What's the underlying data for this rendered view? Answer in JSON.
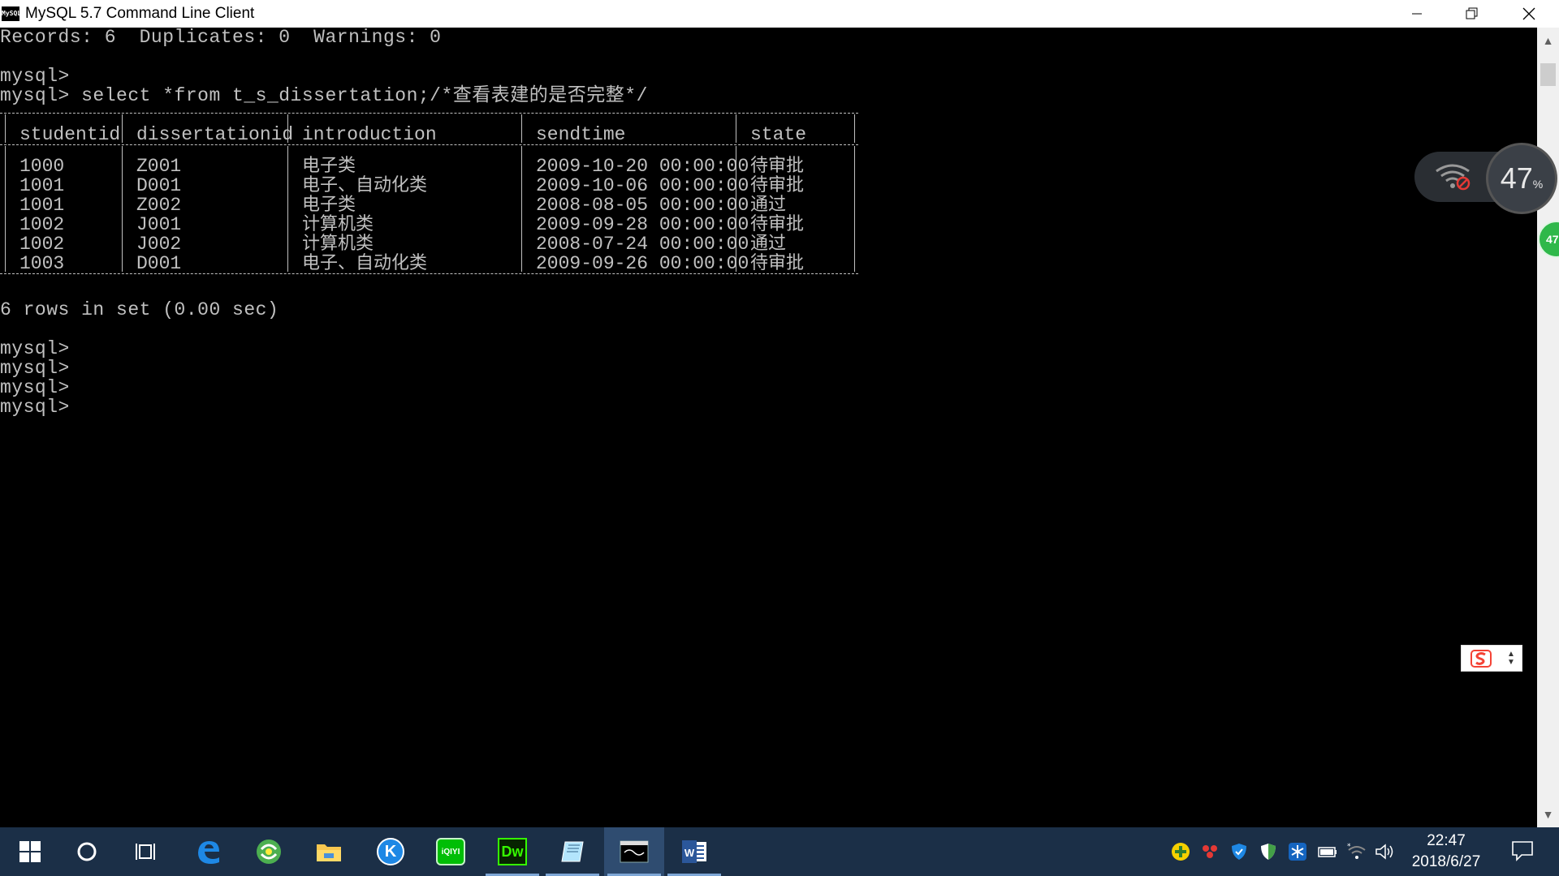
{
  "window": {
    "title": "MySQL 5.7 Command Line Client",
    "icon_label": "MySQL"
  },
  "console": {
    "lines_top": [
      "Records: 6  Duplicates: 0  Warnings: 0",
      "",
      "mysql>",
      "mysql> select *from t_s_dissertation;/*查看表建的是否完整*/"
    ],
    "table": {
      "columns": [
        "studentid",
        "dissertationid",
        "introduction",
        "sendtime",
        "state"
      ],
      "rows": [
        [
          "1000",
          "Z001",
          "电子类",
          "2009-10-20 00:00:00",
          "待审批"
        ],
        [
          "1001",
          "D001",
          "电子、自动化类",
          "2009-10-06 00:00:00",
          "待审批"
        ],
        [
          "1001",
          "Z002",
          "电子类",
          "2008-08-05 00:00:00",
          "通过"
        ],
        [
          "1002",
          "J001",
          "计算机类",
          "2009-09-28 00:00:00",
          "待审批"
        ],
        [
          "1002",
          "J002",
          "计算机类",
          "2008-07-24 00:00:00",
          "通过"
        ],
        [
          "1003",
          "D001",
          "电子、自动化类",
          "2009-09-26 00:00:00",
          "待审批"
        ]
      ]
    },
    "lines_bottom": [
      "6 rows in set (0.00 sec)",
      "",
      "mysql>",
      "mysql>",
      "mysql>",
      "mysql>"
    ]
  },
  "overlays": {
    "network_speed_value": "47",
    "network_speed_unit": "%",
    "green_ball_value": "47"
  },
  "taskbar": {
    "apps": [
      {
        "name": "start-button",
        "icon": "windows-logo-icon"
      },
      {
        "name": "search-button",
        "icon": "cortana-circle-icon"
      },
      {
        "name": "task-view-button",
        "icon": "task-view-icon"
      },
      {
        "name": "edge-button",
        "icon": "edge-icon"
      },
      {
        "name": "browser-360-button",
        "icon": "browser-360-icon"
      },
      {
        "name": "file-explorer-button",
        "icon": "folder-icon"
      },
      {
        "name": "kugou-button",
        "icon": "kugou-icon"
      },
      {
        "name": "iqiyi-button",
        "icon": "iqiyi-icon"
      },
      {
        "name": "dreamweaver-button",
        "icon": "dreamweaver-icon"
      },
      {
        "name": "notebook-app-button",
        "icon": "notebook-icon"
      },
      {
        "name": "mysql-client-button",
        "icon": "mysql-console-icon"
      },
      {
        "name": "word-button",
        "icon": "word-icon"
      }
    ],
    "dreamweaver_label": "Dw",
    "iqiyi_label": "iQIYI",
    "kugou_label": "K",
    "clock": {
      "time": "22:47",
      "date": "2018/6/27"
    }
  }
}
